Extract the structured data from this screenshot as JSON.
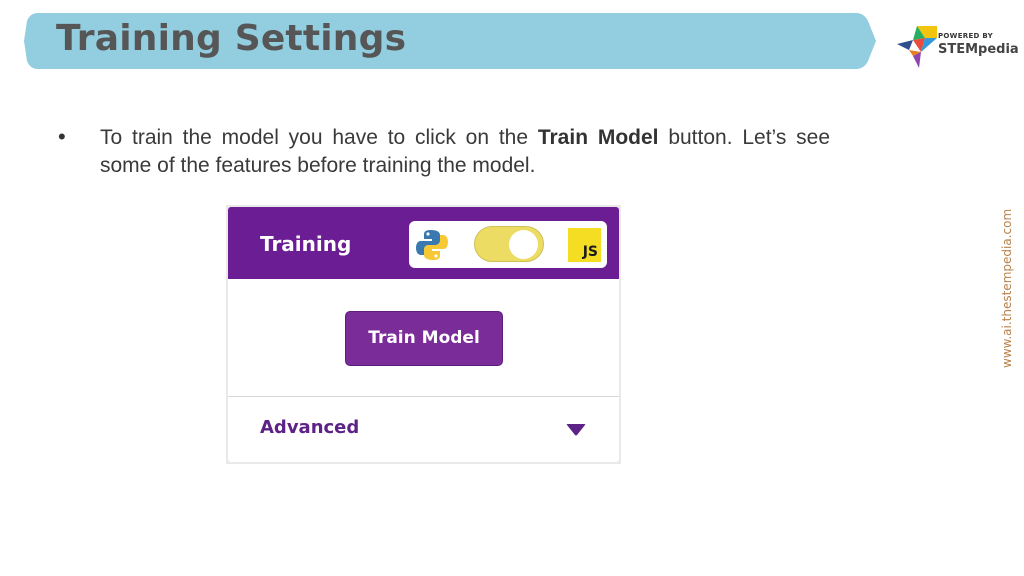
{
  "slide": {
    "title": "Training Settings",
    "logo": {
      "powered_by": "POWERED BY",
      "brand": "STEMpedia"
    },
    "bullet": {
      "text_before": "To train the model you have to click on the ",
      "bold": "Train Model",
      "text_after": " button. Let’s see some of the features before training the model."
    },
    "side_url": "www.ai.thestempedia.com"
  },
  "panel": {
    "header_title": "Training",
    "language_toggle": {
      "left_icon": "python-icon",
      "right_icon": "javascript-icon",
      "right_label": "JS",
      "selected": "JS"
    },
    "train_button_label": "Train Model",
    "advanced_label": "Advanced",
    "colors": {
      "header": "#6b1e93",
      "button": "#7a2c99",
      "toggle": "#ecdc63",
      "title_banner": "#92cde0"
    }
  }
}
